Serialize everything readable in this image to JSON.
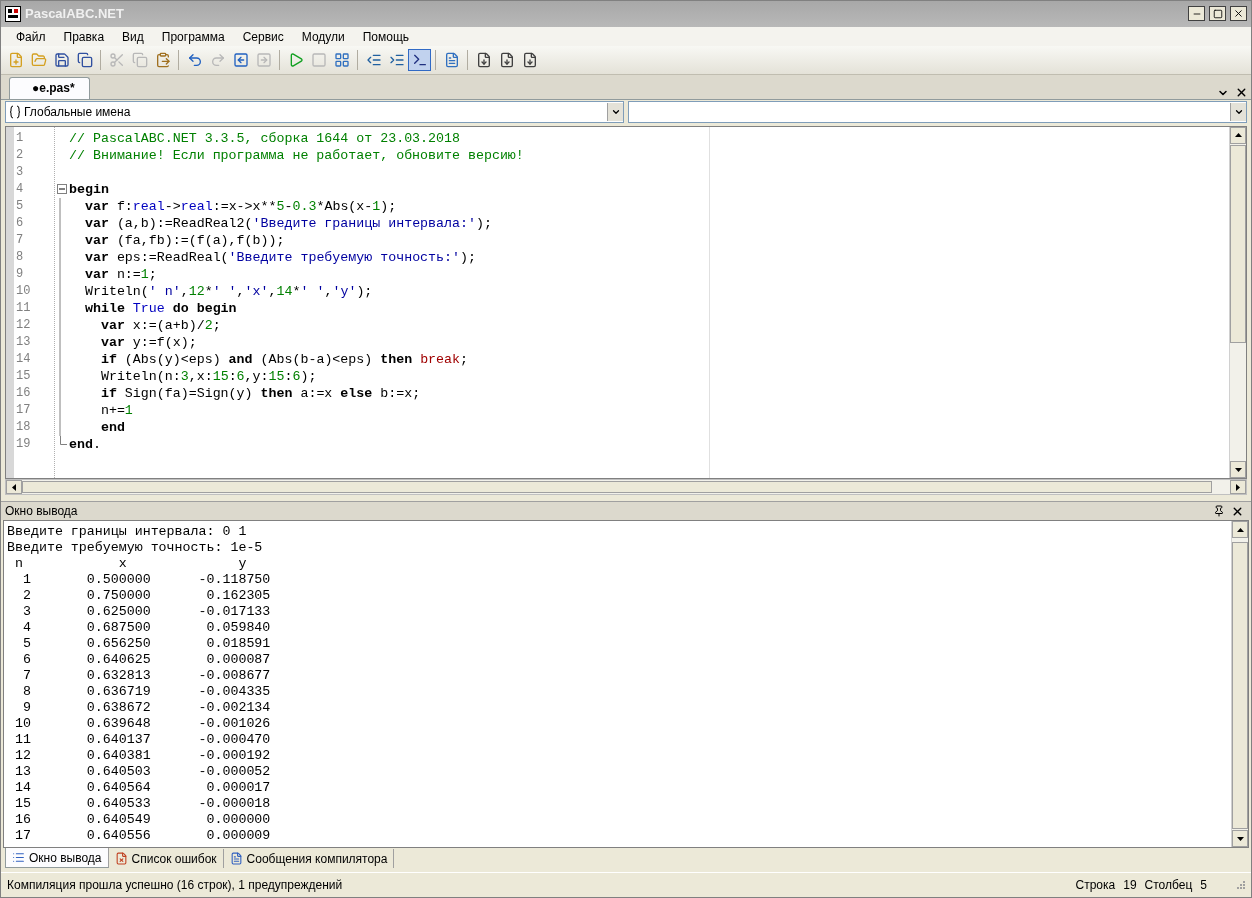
{
  "window": {
    "title": "PascalABC.NET"
  },
  "menu": [
    "Файл",
    "Правка",
    "Вид",
    "Программа",
    "Сервис",
    "Модули",
    "Помощь"
  ],
  "toolbar": [
    [
      {
        "disabled": false,
        "selected": false
      },
      {
        "disabled": false,
        "selected": false
      },
      {
        "disabled": false,
        "selected": false
      },
      {
        "disabled": false,
        "selected": false
      }
    ],
    [
      {
        "disabled": true,
        "selected": false
      },
      {
        "disabled": true,
        "selected": false
      },
      {
        "disabled": false,
        "selected": false
      }
    ],
    [
      {
        "disabled": false,
        "selected": false
      },
      {
        "disabled": true,
        "selected": false
      },
      {
        "disabled": false,
        "selected": false
      },
      {
        "disabled": true,
        "selected": false
      }
    ],
    [
      {
        "disabled": false,
        "selected": false
      },
      {
        "disabled": true,
        "selected": false
      },
      {
        "disabled": false,
        "selected": false
      }
    ],
    [
      {
        "disabled": false,
        "selected": false
      },
      {
        "disabled": false,
        "selected": false
      },
      {
        "disabled": false,
        "selected": true
      }
    ],
    [
      {
        "disabled": false,
        "selected": false
      }
    ],
    [
      {
        "disabled": false,
        "selected": false
      },
      {
        "disabled": false,
        "selected": false
      },
      {
        "disabled": false,
        "selected": false
      }
    ]
  ],
  "document_tabs": [
    {
      "label": "●e.pas*",
      "selected": true
    }
  ],
  "navigation": {
    "scope": "Глобальные имена"
  },
  "editor": {
    "lines": [
      {
        "number": "1",
        "segments": [
          {
            "kind": "comment",
            "text": "// PascalABC.NET 3.3.5, сборка 1644 от 23.03.2018"
          }
        ]
      },
      {
        "number": "2",
        "segments": [
          {
            "kind": "comment",
            "text": "// Внимание! Если программа не работает, обновите версию!"
          }
        ]
      },
      {
        "number": "3"
      },
      {
        "number": "4",
        "foldable": true,
        "expanded": true,
        "segments": [
          {
            "kind": "keyword",
            "text": "begin"
          }
        ]
      },
      {
        "number": "5",
        "segments": [
          {
            "kind": "keyword",
            "text": "  var"
          },
          {
            "kind": "text",
            "text": " f:"
          },
          {
            "kind": "type",
            "text": "real"
          },
          {
            "kind": "text",
            "text": "->"
          },
          {
            "kind": "type",
            "text": "real"
          },
          {
            "kind": "text",
            "text": ":=x->x**"
          },
          {
            "kind": "number",
            "text": "5"
          },
          {
            "kind": "text",
            "text": "-"
          },
          {
            "kind": "number",
            "text": "0.3"
          },
          {
            "kind": "text",
            "text": "*Abs(x-"
          },
          {
            "kind": "number",
            "text": "1"
          },
          {
            "kind": "text",
            "text": ");"
          }
        ]
      },
      {
        "number": "6",
        "segments": [
          {
            "kind": "keyword",
            "text": "  var"
          },
          {
            "kind": "text",
            "text": " (a,b):=ReadReal2("
          },
          {
            "kind": "string",
            "text": "'Введите границы интервала:'"
          },
          {
            "kind": "text",
            "text": ");"
          }
        ]
      },
      {
        "number": "7",
        "segments": [
          {
            "kind": "keyword",
            "text": "  var"
          },
          {
            "kind": "text",
            "text": " (fa,fb):=(f(a),f(b));"
          }
        ]
      },
      {
        "number": "8",
        "segments": [
          {
            "kind": "keyword",
            "text": "  var"
          },
          {
            "kind": "text",
            "text": " eps:=ReadReal("
          },
          {
            "kind": "string",
            "text": "'Введите требуемую точность:'"
          },
          {
            "kind": "text",
            "text": ");"
          }
        ]
      },
      {
        "number": "9",
        "segments": [
          {
            "kind": "keyword",
            "text": "  var"
          },
          {
            "kind": "text",
            "text": " n:="
          },
          {
            "kind": "number",
            "text": "1"
          },
          {
            "kind": "text",
            "text": ";"
          }
        ]
      },
      {
        "number": "10",
        "segments": [
          {
            "kind": "text",
            "text": "  Writeln("
          },
          {
            "kind": "string",
            "text": "' n'"
          },
          {
            "kind": "text",
            "text": ","
          },
          {
            "kind": "number",
            "text": "12"
          },
          {
            "kind": "text",
            "text": "*"
          },
          {
            "kind": "string",
            "text": "' '"
          },
          {
            "kind": "text",
            "text": ","
          },
          {
            "kind": "string",
            "text": "'x'"
          },
          {
            "kind": "text",
            "text": ","
          },
          {
            "kind": "number",
            "text": "14"
          },
          {
            "kind": "text",
            "text": "*"
          },
          {
            "kind": "string",
            "text": "' '"
          },
          {
            "kind": "text",
            "text": ","
          },
          {
            "kind": "string",
            "text": "'y'"
          },
          {
            "kind": "text",
            "text": ");"
          }
        ]
      },
      {
        "number": "11",
        "segments": [
          {
            "kind": "keyword",
            "text": "  while"
          },
          {
            "kind": "type",
            "text": " True"
          },
          {
            "kind": "keyword",
            "text": " do begin"
          }
        ]
      },
      {
        "number": "12",
        "segments": [
          {
            "kind": "keyword",
            "text": "    var"
          },
          {
            "kind": "text",
            "text": " x:=(a+b)/"
          },
          {
            "kind": "number",
            "text": "2"
          },
          {
            "kind": "text",
            "text": ";"
          }
        ]
      },
      {
        "number": "13",
        "segments": [
          {
            "kind": "keyword",
            "text": "    var"
          },
          {
            "kind": "text",
            "text": " y:=f(x);"
          }
        ]
      },
      {
        "number": "14",
        "segments": [
          {
            "kind": "keyword",
            "text": "    if"
          },
          {
            "kind": "text",
            "text": " (Abs(y)<eps) "
          },
          {
            "kind": "keyword",
            "text": "and"
          },
          {
            "kind": "text",
            "text": " (Abs(b-a)<eps) "
          },
          {
            "kind": "keyword",
            "text": "then"
          },
          {
            "kind": "special",
            "text": " break"
          },
          {
            "kind": "text",
            "text": ";"
          }
        ]
      },
      {
        "number": "15",
        "segments": [
          {
            "kind": "text",
            "text": "    Writeln(n:"
          },
          {
            "kind": "number",
            "text": "3"
          },
          {
            "kind": "text",
            "text": ",x:"
          },
          {
            "kind": "number",
            "text": "15"
          },
          {
            "kind": "text",
            "text": ":"
          },
          {
            "kind": "number",
            "text": "6"
          },
          {
            "kind": "text",
            "text": ",y:"
          },
          {
            "kind": "number",
            "text": "15"
          },
          {
            "kind": "text",
            "text": ":"
          },
          {
            "kind": "number",
            "text": "6"
          },
          {
            "kind": "text",
            "text": ");"
          }
        ]
      },
      {
        "number": "16",
        "segments": [
          {
            "kind": "keyword",
            "text": "    if"
          },
          {
            "kind": "text",
            "text": " Sign(fa)=Sign(y) "
          },
          {
            "kind": "keyword",
            "text": "then"
          },
          {
            "kind": "text",
            "text": " a:=x "
          },
          {
            "kind": "keyword",
            "text": "else"
          },
          {
            "kind": "text",
            "text": " b:=x;"
          }
        ]
      },
      {
        "number": "17",
        "segments": [
          {
            "kind": "text",
            "text": "    n+="
          },
          {
            "kind": "number",
            "text": "1"
          }
        ]
      },
      {
        "number": "18",
        "segments": [
          {
            "kind": "keyword",
            "text": "    end"
          }
        ]
      },
      {
        "number": "19",
        "fold_end": true,
        "segments": [
          {
            "kind": "keyword",
            "text": "end"
          },
          {
            "kind": "text",
            "text": "."
          }
        ]
      }
    ]
  },
  "output": {
    "title": "Окно вывода",
    "lines": [
      "Введите границы интервала: 0 1",
      "Введите требуемую точность: 1e-5",
      " n            x              y",
      "  1       0.500000      -0.118750",
      "  2       0.750000       0.162305",
      "  3       0.625000      -0.017133",
      "  4       0.687500       0.059840",
      "  5       0.656250       0.018591",
      "  6       0.640625       0.000087",
      "  7       0.632813      -0.008677",
      "  8       0.636719      -0.004335",
      "  9       0.638672      -0.002134",
      " 10       0.639648      -0.001026",
      " 11       0.640137      -0.000470",
      " 12       0.640381      -0.000192",
      " 13       0.640503      -0.000052",
      " 14       0.640564       0.000017",
      " 15       0.640533      -0.000018",
      " 16       0.640549       0.000000",
      " 17       0.640556       0.000009"
    ]
  },
  "bottom_tabs": [
    {
      "label": "Окно вывода",
      "kind": "output",
      "selected": true
    },
    {
      "label": "Список ошибок",
      "kind": "errors",
      "selected": false
    },
    {
      "label": "Сообщения компилятора",
      "kind": "messages",
      "selected": false
    }
  ],
  "status_bar": {
    "message": "Компиляция прошла успешно (16 строк), 1 предупреждений",
    "line_label": "Строка",
    "line": "19",
    "column_label": "Столбец",
    "column": "5"
  }
}
